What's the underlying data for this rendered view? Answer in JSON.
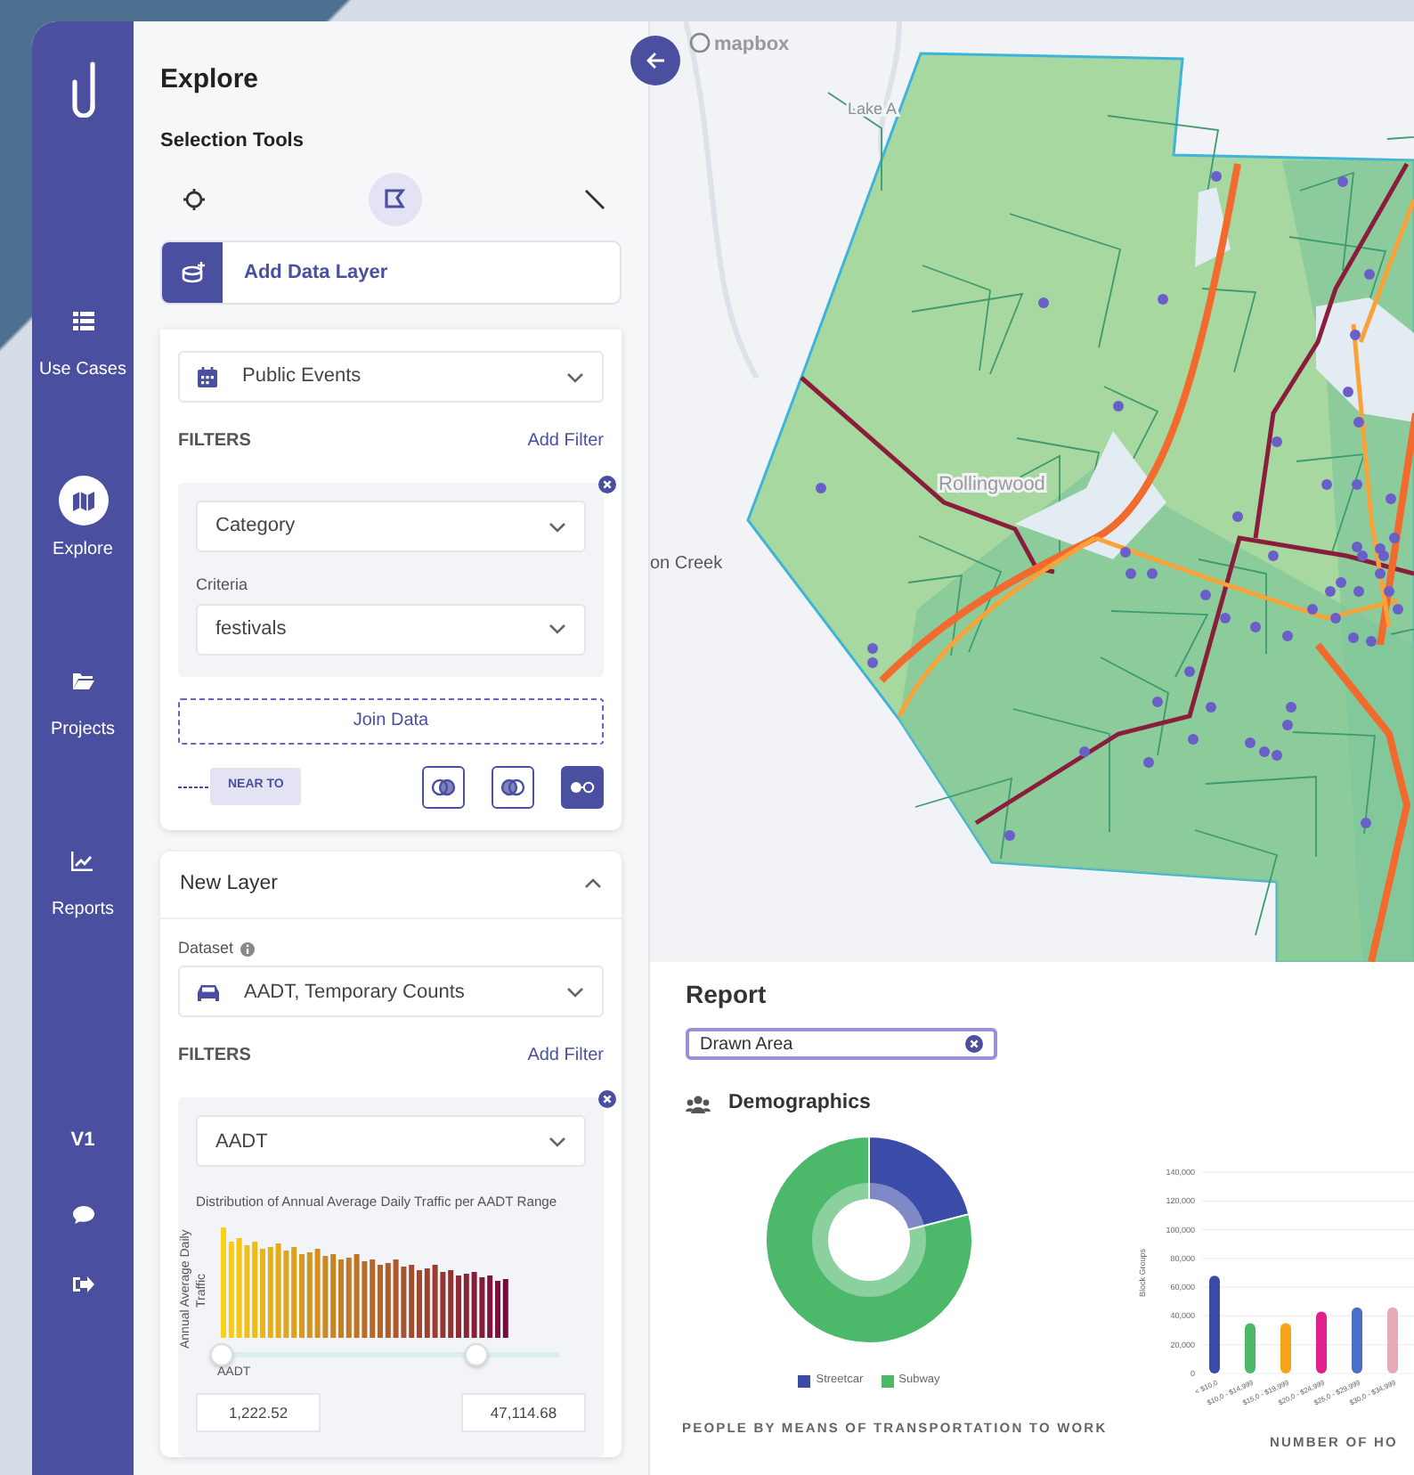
{
  "nav": {
    "items": [
      {
        "kind": "list",
        "label": "Use Cases",
        "selected": false
      },
      {
        "kind": "map",
        "label": "Explore",
        "selected": true
      },
      {
        "kind": "folder",
        "label": "Projects",
        "selected": false
      },
      {
        "kind": "chart",
        "label": "Reports",
        "selected": false
      }
    ],
    "version": "V1"
  },
  "panel": {
    "title": "Explore",
    "selection_tools": {
      "label": "Selection Tools",
      "tools": [
        {
          "kind": "point",
          "selected": false
        },
        {
          "kind": "polygon",
          "selected": true
        },
        {
          "kind": "line",
          "selected": false
        }
      ]
    },
    "add_layer": "Add Data Layer",
    "layers": [
      {
        "kind": "events",
        "dataset": "Public Events",
        "filters_label": "FILTERS",
        "add_filter": "Add Filter",
        "filter": {
          "field": "Category",
          "criteria_label": "Criteria",
          "criteria": "festivals"
        },
        "join": "Join Data",
        "near_to": "NEAR TO",
        "modes": [
          {
            "kind": "left",
            "selected": false
          },
          {
            "kind": "right",
            "selected": false
          },
          {
            "kind": "dots",
            "selected": true
          }
        ]
      },
      {
        "kind": "traffic",
        "title": "New Layer",
        "expanded": true,
        "dataset_label": "Dataset",
        "dataset": "AADT, Temporary Counts",
        "filters_label": "FILTERS",
        "add_filter": "Add Filter",
        "filter": {
          "field": "AADT",
          "caption": "Distribution of Annual Average Daily Traffic per AADT Range",
          "ylabel": "Annual Average Daily Traffic",
          "xlabel": "AADT",
          "low": {
            "level": 0,
            "value": "1,222.52"
          },
          "high": {
            "level": 0.75,
            "value": "47,114.68"
          }
        }
      }
    ]
  },
  "map": {
    "logo": "mapbox",
    "labels": [
      "Lake A",
      "Rollingwood",
      "on Creek"
    ]
  },
  "report": {
    "title": "Report",
    "area": "Drawn Area",
    "section": "Demographics",
    "donut": {
      "legend": [
        {
          "label": "Streetcar",
          "color": "#3b4ba8"
        },
        {
          "label": "Subway",
          "color": "#4cb96a"
        }
      ],
      "caption": "PEOPLE BY MEANS OF TRANSPORTATION TO WORK"
    },
    "bars": {
      "chart_data": {
        "type": "bar",
        "ylabel": "Block Groups",
        "categories": [
          "< $10,0",
          "$10,0 - $14,999",
          "$15,0 - $19,999",
          "$20,0 - $24,999",
          "$25,0 - $29,999",
          "$30,0 - $34,999"
        ],
        "series": [
          {
            "values": [
              68000,
              35000,
              35000,
              43000,
              46000,
              46000
            ]
          }
        ],
        "grid": true,
        "ylim": [
          0,
          140000
        ],
        "yticks": [
          {
            "value": 0,
            "label": "0"
          },
          {
            "value": 20000,
            "label": "20,000"
          },
          {
            "value": 40000,
            "label": "40,000"
          },
          {
            "value": 60000,
            "label": "60,000"
          },
          {
            "value": 80000,
            "label": "80,000"
          },
          {
            "value": 100000,
            "label": "100,000"
          },
          {
            "value": 120000,
            "label": "120,000"
          },
          {
            "value": 140000,
            "label": "140,000"
          }
        ]
      },
      "caption": "NUMBER OF HO"
    }
  }
}
